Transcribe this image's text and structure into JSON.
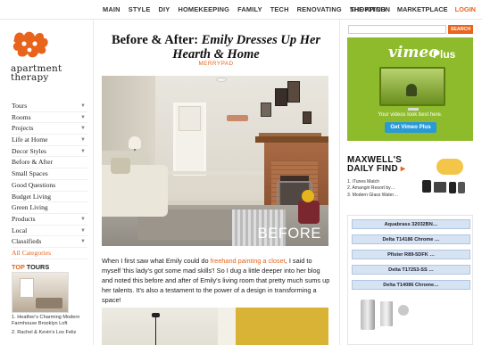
{
  "topnav": {
    "items": [
      "MAIN",
      "STYLE",
      "DIY",
      "HOMEKEEPING",
      "FAMILY",
      "TECH",
      "RENOVATING",
      "SHOPPING"
    ],
    "right": {
      "kitchn": "THE KITCHN",
      "marketplace": "MARKETPLACE",
      "login": "LOGIN"
    }
  },
  "logo": {
    "line1": "apartment",
    "line2": "therapy",
    "accent": "#e8631c"
  },
  "sidebar": {
    "items": [
      {
        "label": "Tours",
        "chevron": true
      },
      {
        "label": "Rooms",
        "chevron": true
      },
      {
        "label": "Projects",
        "chevron": true
      },
      {
        "label": "Life at Home",
        "chevron": true
      },
      {
        "label": "Decor Styles",
        "chevron": true
      },
      {
        "label": "Before & After",
        "chevron": false
      },
      {
        "label": "Small Spaces",
        "chevron": false
      },
      {
        "label": "Good Questions",
        "chevron": false
      },
      {
        "label": "Budget Living",
        "chevron": false
      },
      {
        "label": "Green Living",
        "chevron": false
      },
      {
        "label": "Products",
        "chevron": true
      },
      {
        "label": "Local",
        "chevron": true
      },
      {
        "label": "Classifieds",
        "chevron": true
      }
    ],
    "all_categories": "All Categories"
  },
  "top_tours": {
    "heading_top": "TOP",
    "heading_rest": " TOURS",
    "items": [
      "1. Heather's Charming Modern Farmhouse Brooklyn Loft",
      "2. Rachel & Kevin's Los Feliz"
    ]
  },
  "article": {
    "title_plain": "Before & After: ",
    "title_italic": "Emily Dresses Up Her Hearth & Home",
    "byline": "MERRYPAD",
    "photo_caption": "BEFORE",
    "para_pre": "When I first saw what Emily could do ",
    "para_link": "freehand painting a closet",
    "para_post": ", I said to myself 'this lady's got some mad skills'! So I dug a little deeper into her blog and noted this before and after of Emily's living room that pretty much sums up her talents. It's also a testament to the power of a design in transforming a space!"
  },
  "ads": {
    "search_label": "SEARCH",
    "vimeo": {
      "brand": "vimeo",
      "plus": "Plus",
      "tagline": "Your videos look best here.",
      "cta": "Get Vimeo Plus",
      "color": "#8ebb2b"
    },
    "maxwell": {
      "line1": "MAXWELL'S",
      "line2_a": "DAILY FIND",
      "line2_b": " ▸",
      "items": [
        "1. iTunes Match",
        "2. Amangiri Resort by…",
        "3. Modern Glass Water…"
      ]
    },
    "delta": {
      "rows": [
        "Aquabrass 32032BN…",
        "Delta T14186 Chrome …",
        "Pfister R89-5DFK …",
        "Delta T17253-SS …",
        "Delta T14086 Chrome…"
      ]
    }
  }
}
